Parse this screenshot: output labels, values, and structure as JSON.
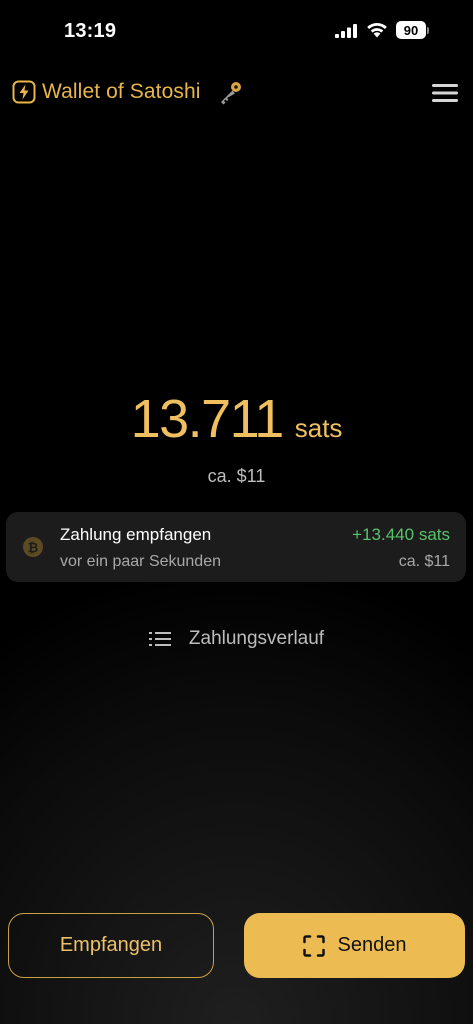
{
  "status_bar": {
    "time": "13:19",
    "battery": "90",
    "icons": [
      "signal-icon",
      "wifi-icon",
      "battery-icon"
    ]
  },
  "header": {
    "title": "Wallet of Satoshi",
    "icons": [
      "lightning-bolt-icon",
      "key-icon",
      "menu-icon"
    ]
  },
  "balance": {
    "value": "13.711",
    "unit": "sats",
    "fiat": "ca. $11"
  },
  "recent_payment": {
    "title": "Zahlung empfangen",
    "time": "vor ein paar Sekunden",
    "amount": "+13.440 sats",
    "fiat": "ca. $11",
    "icon": "bitcoin-icon"
  },
  "history": {
    "label": "Zahlungsverlauf",
    "icon": "list-icon"
  },
  "actions": {
    "receive_label": "Empfangen",
    "send_label": "Senden",
    "send_icon": "scan-icon"
  },
  "colors": {
    "accent": "#ecbc52",
    "accent_text": "#f0c060",
    "positive": "#59c36a",
    "card_bg": "#1c1c1c",
    "background": "#000000"
  }
}
